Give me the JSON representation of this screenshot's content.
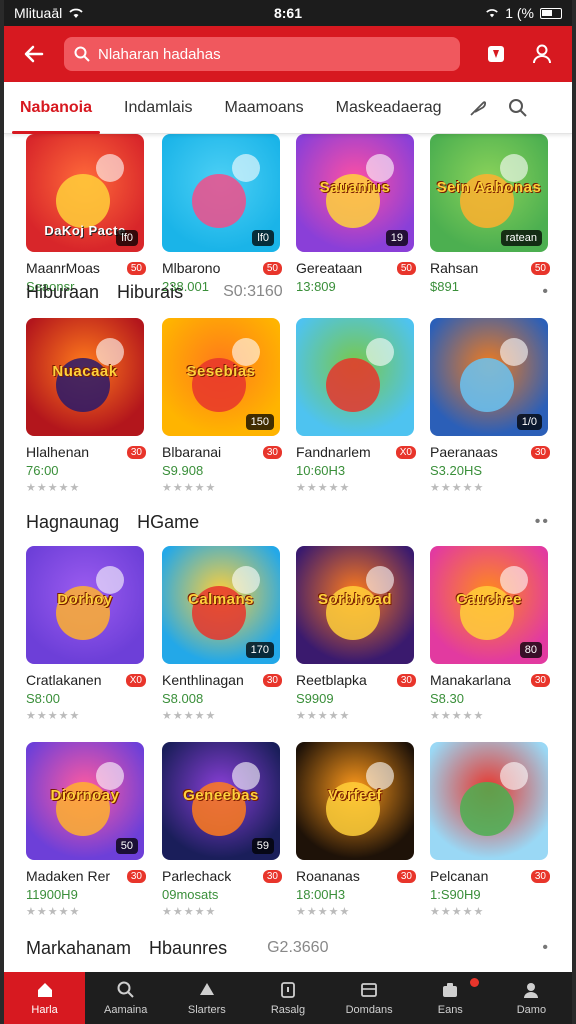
{
  "status": {
    "carrier": "Mlituaāl",
    "time": "8:61",
    "battery": "1 (%"
  },
  "appbar": {
    "search_placeholder": "Nlaharan hadahas"
  },
  "tabs": [
    "Nabanoia",
    "Indamlais",
    "Maamoans",
    "Maskeadaerag"
  ],
  "sections": [
    {
      "title": "",
      "sub": "",
      "count": "",
      "cards": [
        {
          "name": "MaanrMoas",
          "meta": "Seaonsr",
          "badge": "lf0",
          "pill": "50",
          "caption": "DaKoj Pacte",
          "colors": [
            "#d8262a",
            "#ff6a3a",
            "#ffcf3a"
          ]
        },
        {
          "name": "Mlbarono",
          "meta": "238.001",
          "badge": "lf0",
          "pill": "50",
          "caption": "",
          "colors": [
            "#1ab4e8",
            "#4dd0f5",
            "#f24d8a"
          ]
        },
        {
          "name": "Gereataan",
          "meta": "13:809",
          "badge": "19",
          "pill": "50",
          "caption": "Sauanius",
          "colors": [
            "#8a3fd8",
            "#ff4fa3",
            "#ffd23b"
          ]
        },
        {
          "name": "Rahsan",
          "meta": "$891",
          "badge": "ratean",
          "pill": "50",
          "caption": "Sein Aahonas",
          "colors": [
            "#4caf50",
            "#8bd35a",
            "#ffb02e"
          ]
        }
      ]
    },
    {
      "title": "Hiburaan",
      "sub": "Hiburais",
      "count": "S0:3160",
      "more": "•",
      "cards": [
        {
          "name": "Hlalhenan",
          "meta": "76:00",
          "badge": "",
          "pill": "30",
          "caption": "Nuacaak",
          "colors": [
            "#b3161c",
            "#ff7b1c",
            "#2a1a6a"
          ]
        },
        {
          "name": "Blbaranai",
          "meta": "S9.908",
          "badge": "150",
          "pill": "30",
          "caption": "Sesebias",
          "colors": [
            "#ffb400",
            "#ff7a1a",
            "#e8352b"
          ]
        },
        {
          "name": "Fandnarlem",
          "meta": "10:60H3",
          "badge": "",
          "pill": "X0",
          "caption": "",
          "colors": [
            "#4ec3f0",
            "#79c84a",
            "#e8352b"
          ]
        },
        {
          "name": "Paeranaas",
          "meta": "S3.20HS",
          "badge": "1/0",
          "pill": "30",
          "caption": "",
          "colors": [
            "#2b5fb8",
            "#f07b1e",
            "#6ac3f2"
          ]
        }
      ]
    },
    {
      "title": "Hagnaunag",
      "sub": "HGame",
      "count": "",
      "more": "••",
      "cards": [
        {
          "name": "Cratlakanen",
          "meta": "S8:00",
          "badge": "",
          "pill": "X0",
          "caption": "Dorhoy",
          "colors": [
            "#6d3fd8",
            "#9c5cf0",
            "#ffb02e"
          ]
        },
        {
          "name": "Kenthlinagan",
          "meta": "S8.008",
          "badge": "170",
          "pill": "30",
          "caption": "Calmans",
          "colors": [
            "#23a8e8",
            "#ffcf3a",
            "#e8352b"
          ]
        },
        {
          "name": "Reetblapka",
          "meta": "S9909",
          "badge": "",
          "pill": "30",
          "caption": "Sorbhoad",
          "colors": [
            "#3a1a6e",
            "#ff7b1c",
            "#ffcf3a"
          ]
        },
        {
          "name": "Manakarlana",
          "meta": "S8.30",
          "badge": "80",
          "pill": "30",
          "caption": "Cauchee",
          "colors": [
            "#e23aa0",
            "#ff8a1c",
            "#ffcf3a"
          ]
        }
      ]
    },
    {
      "title": "",
      "sub": "",
      "count": "",
      "cards": [
        {
          "name": "Madaken Rer",
          "meta": "11900H9",
          "badge": "50",
          "pill": "30",
          "caption": "Diornoay",
          "colors": [
            "#6d3fd8",
            "#ff5aa0",
            "#ffb02e"
          ]
        },
        {
          "name": "Parlechack",
          "meta": "09mosats",
          "badge": "59",
          "pill": "30",
          "caption": "Geneebas",
          "colors": [
            "#1a1e5a",
            "#8a3fd8",
            "#ff7b1c"
          ]
        },
        {
          "name": "Roananas",
          "meta": "18:00H3",
          "badge": "",
          "pill": "30",
          "caption": "Vorfeef",
          "colors": [
            "#1e1208",
            "#ff9a1c",
            "#ffcf3a"
          ]
        },
        {
          "name": "Pelcanan",
          "meta": "1:S90H9",
          "badge": "",
          "pill": "30",
          "caption": "",
          "colors": [
            "#9ad8f5",
            "#e8352b",
            "#4caf50"
          ]
        }
      ]
    },
    {
      "title": "Markahanam",
      "sub": "Hbaunres",
      "count": "G2.3660",
      "more": "•",
      "cards": []
    }
  ],
  "bottom_nav": [
    {
      "label": "Harla",
      "icon": "home-icon"
    },
    {
      "label": "Aamaina",
      "icon": "search-icon"
    },
    {
      "label": "Slarters",
      "icon": "game-icon"
    },
    {
      "label": "Rasalg",
      "icon": "info-icon"
    },
    {
      "label": "Domdans",
      "icon": "list-icon"
    },
    {
      "label": "Eans",
      "icon": "gift-icon"
    },
    {
      "label": "Damo",
      "icon": "user-icon"
    }
  ],
  "colors": {
    "brand_red": "#d71920"
  }
}
